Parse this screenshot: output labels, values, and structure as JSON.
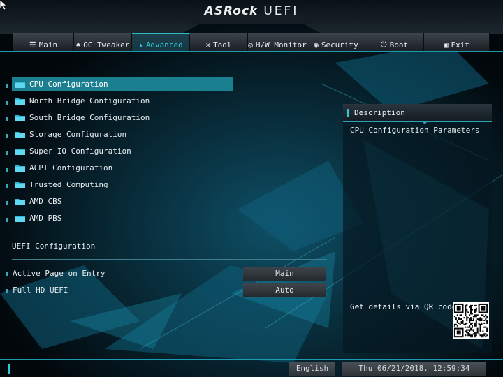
{
  "header": {
    "brand": "ASRock",
    "product": "UEFI"
  },
  "nav": {
    "tabs": [
      {
        "label": "Main",
        "icon": "list-icon",
        "glyph": "☰",
        "active": false
      },
      {
        "label": "OC Tweaker",
        "icon": "rocket-icon",
        "glyph": "♠",
        "active": false
      },
      {
        "label": "Advanced",
        "icon": "star-icon",
        "glyph": "★",
        "active": true
      },
      {
        "label": "Tool",
        "icon": "tool-icon",
        "glyph": "✕",
        "active": false
      },
      {
        "label": "H/W Monitor",
        "icon": "monitor-icon",
        "glyph": "◎",
        "active": false
      },
      {
        "label": "Security",
        "icon": "shield-icon",
        "glyph": "◉",
        "active": false
      },
      {
        "label": "Boot",
        "icon": "power-icon",
        "glyph": "⏻",
        "active": false
      },
      {
        "label": "Exit",
        "icon": "exit-icon",
        "glyph": "▣",
        "active": false
      }
    ]
  },
  "menu": {
    "items": [
      {
        "label": "CPU Configuration",
        "selected": true
      },
      {
        "label": "North Bridge Configuration",
        "selected": false
      },
      {
        "label": "South Bridge Configuration",
        "selected": false
      },
      {
        "label": "Storage Configuration",
        "selected": false
      },
      {
        "label": "Super IO Configuration",
        "selected": false
      },
      {
        "label": "ACPI Configuration",
        "selected": false
      },
      {
        "label": "Trusted Computing",
        "selected": false
      },
      {
        "label": "AMD CBS",
        "selected": false
      },
      {
        "label": "AMD PBS",
        "selected": false
      }
    ]
  },
  "uefi_config": {
    "heading": "UEFI Configuration",
    "options": [
      {
        "label": "Active Page on Entry",
        "value": "Main"
      },
      {
        "label": "Full HD UEFI",
        "value": "Auto"
      }
    ]
  },
  "description": {
    "title": "Description",
    "text": "CPU Configuration Parameters",
    "qr_text": "Get details via QR code"
  },
  "status": {
    "language": "English",
    "datetime": "Thu 06/21/2018. 12:59:34"
  },
  "colors": {
    "accent": "#2ec8dc",
    "highlight": "#1a7f8f",
    "background": "#02070b"
  }
}
